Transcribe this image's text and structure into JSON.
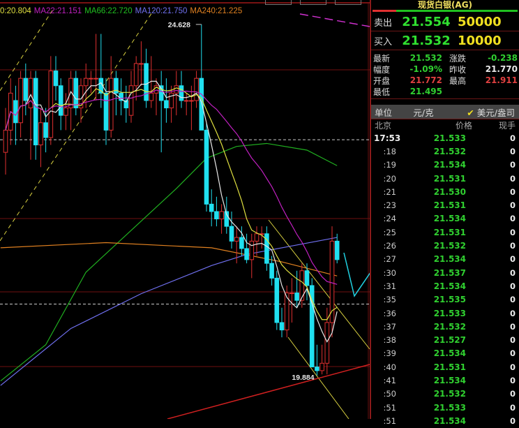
{
  "chart": {
    "legend": [
      {
        "label": "0:20.804",
        "color": "#e0e040"
      },
      {
        "label": "MA22:21.151",
        "color": "#c020c0"
      },
      {
        "label": "MA66:22.720",
        "color": "#20c020"
      },
      {
        "label": "MA120:21.750",
        "color": "#7070f0"
      },
      {
        "label": "MA240:21.225",
        "color": "#e08020"
      }
    ],
    "high_label": "24.628",
    "low_label": "19.884",
    "colors": {
      "up": "#e03030",
      "down": "#20e0f0",
      "grid": "#701010"
    }
  },
  "chart_data": {
    "type": "candlestick",
    "ylim": [
      19.4,
      24.95
    ],
    "hlines_dashed": [
      23.07,
      20.85
    ],
    "candles": [
      [
        22.9,
        23.5,
        22.6,
        23.2
      ],
      [
        23.2,
        23.9,
        23.0,
        23.7
      ],
      [
        23.6,
        23.8,
        23.0,
        23.3
      ],
      [
        23.3,
        24.0,
        23.1,
        23.9
      ],
      [
        23.9,
        24.1,
        23.4,
        23.6
      ],
      [
        23.5,
        24.0,
        22.8,
        23.9
      ],
      [
        23.9,
        24.0,
        22.8,
        23.0
      ],
      [
        23.0,
        23.5,
        22.7,
        23.3
      ],
      [
        23.3,
        23.5,
        22.9,
        23.1
      ],
      [
        23.1,
        24.2,
        23.0,
        24.0
      ],
      [
        24.0,
        24.2,
        23.6,
        23.8
      ],
      [
        23.8,
        23.9,
        23.2,
        23.4
      ],
      [
        23.4,
        23.7,
        23.2,
        23.5
      ],
      [
        23.5,
        24.0,
        23.2,
        23.9
      ],
      [
        23.9,
        24.0,
        23.4,
        23.5
      ],
      [
        23.5,
        23.9,
        23.3,
        23.8
      ],
      [
        23.8,
        24.1,
        23.5,
        23.9
      ],
      [
        23.9,
        24.0,
        23.7,
        23.9
      ],
      [
        23.9,
        24.5,
        23.6,
        23.9
      ],
      [
        23.9,
        24.5,
        23.5,
        23.7
      ],
      [
        23.7,
        23.9,
        23.0,
        23.2
      ],
      [
        23.2,
        24.2,
        23.1,
        23.9
      ],
      [
        23.9,
        24.0,
        23.4,
        23.7
      ],
      [
        23.7,
        23.9,
        23.4,
        23.6
      ],
      [
        23.6,
        23.8,
        23.3,
        23.5
      ],
      [
        23.4,
        24.0,
        23.3,
        23.8
      ],
      [
        23.8,
        24.2,
        23.6,
        24.1
      ],
      [
        24.1,
        24.4,
        23.8,
        24.1
      ],
      [
        24.1,
        24.3,
        23.5,
        23.6
      ],
      [
        23.6,
        24.2,
        23.5,
        23.7
      ],
      [
        23.7,
        23.9,
        23.4,
        23.8
      ],
      [
        23.8,
        24.0,
        22.9,
        23.6
      ],
      [
        23.6,
        23.9,
        23.3,
        23.5
      ],
      [
        23.5,
        23.8,
        23.3,
        23.7
      ],
      [
        23.7,
        24.0,
        23.4,
        23.8
      ],
      [
        23.8,
        24.0,
        23.5,
        23.6
      ],
      [
        23.6,
        23.7,
        23.4,
        23.6
      ],
      [
        23.6,
        23.8,
        23.2,
        23.6
      ],
      [
        23.6,
        24.0,
        23.5,
        23.9
      ],
      [
        23.9,
        24.628,
        23.7,
        23.2
      ],
      [
        23.2,
        23.3,
        22.1,
        22.2
      ],
      [
        22.2,
        22.4,
        21.9,
        22.1
      ],
      [
        22.1,
        22.3,
        21.9,
        22.0
      ],
      [
        22.0,
        22.2,
        21.8,
        22.1
      ],
      [
        22.1,
        22.3,
        21.8,
        21.9
      ],
      [
        21.9,
        22.1,
        21.6,
        21.7
      ],
      [
        21.7,
        21.9,
        21.4,
        21.75
      ],
      [
        21.75,
        21.9,
        21.5,
        21.6
      ],
      [
        21.6,
        21.8,
        21.4,
        21.45
      ],
      [
        21.45,
        21.8,
        21.2,
        21.7
      ],
      [
        21.7,
        21.9,
        21.5,
        21.8
      ],
      [
        21.8,
        21.9,
        21.6,
        21.8
      ],
      [
        21.8,
        21.9,
        21.3,
        21.4
      ],
      [
        21.4,
        21.5,
        21.1,
        21.2
      ],
      [
        21.2,
        21.3,
        20.5,
        20.6
      ],
      [
        20.6,
        20.8,
        20.4,
        20.5
      ],
      [
        20.5,
        21.1,
        20.4,
        21.0
      ],
      [
        21.0,
        21.2,
        20.6,
        21.0
      ],
      [
        21.0,
        21.3,
        20.8,
        20.9
      ],
      [
        20.9,
        21.4,
        20.8,
        21.3
      ],
      [
        21.3,
        21.4,
        20.9,
        21.1
      ],
      [
        21.1,
        21.2,
        20.1,
        20.0
      ],
      [
        20.0,
        20.3,
        19.884,
        19.95
      ],
      [
        19.95,
        20.3,
        19.9,
        20.05
      ],
      [
        20.05,
        20.8,
        19.9,
        20.6
      ],
      [
        20.6,
        21.9,
        20.4,
        21.7
      ],
      [
        21.7,
        21.8,
        21.4,
        21.45
      ]
    ],
    "ma_short": [
      {
        "name": "MA5",
        "period": 5,
        "color": "#e8e8e8"
      },
      {
        "name": "MA10",
        "period": 10,
        "color": "#e0e040"
      },
      {
        "name": "MA22",
        "period": 22,
        "color": "#c020c0"
      }
    ],
    "ma_long": [
      {
        "name": "MA66",
        "color": "#20b020",
        "points": [
          [
            -1,
            19.81
          ],
          [
            8,
            20.3
          ],
          [
            16,
            21.28
          ],
          [
            34,
            22.41
          ],
          [
            40,
            22.82
          ],
          [
            46,
            22.98
          ],
          [
            52,
            23.02
          ],
          [
            60,
            22.93
          ],
          [
            66,
            22.72
          ]
        ]
      },
      {
        "name": "MA120",
        "color": "#7070f0",
        "points": [
          [
            -1,
            19.75
          ],
          [
            13,
            20.52
          ],
          [
            27,
            20.99
          ],
          [
            41,
            21.37
          ],
          [
            48,
            21.52
          ],
          [
            55,
            21.61
          ],
          [
            66,
            21.75
          ]
        ]
      },
      {
        "name": "MA240",
        "color": "#e08020",
        "points": [
          [
            -1,
            21.61
          ],
          [
            20,
            21.68
          ],
          [
            41,
            21.61
          ],
          [
            55,
            21.42
          ],
          [
            66,
            21.23
          ]
        ]
      }
    ]
  },
  "panel": {
    "title": "现货白银(AG)",
    "sell": {
      "label": "卖出",
      "price": "21.554",
      "volume": "50000"
    },
    "buy": {
      "label": "买入",
      "price": "21.532",
      "volume": "10000"
    },
    "stats": [
      {
        "k": "最新",
        "v": "21.532",
        "vc": "g",
        "k2": "涨跌",
        "v2": "-0.238",
        "v2c": "g"
      },
      {
        "k": "幅度",
        "v": "-1.09%",
        "vc": "g",
        "k2": "昨收",
        "v2": "21.770",
        "v2c": "w"
      },
      {
        "k": "开盘",
        "v": "21.772",
        "vc": "rd",
        "k2": "最高",
        "v2": "21.911",
        "v2c": "rd"
      },
      {
        "k": "最低",
        "v": "21.495",
        "vc": "g",
        "k2": "",
        "v2": "",
        "v2c": "w"
      }
    ],
    "unit": {
      "label": "单位",
      "opt1": "元/克",
      "check": "✔",
      "opt2": "美元/盎司"
    },
    "table_header": {
      "time": "北京",
      "price": "价格",
      "vol": "现手"
    },
    "ticks": [
      {
        "t": "17:53",
        "p": "21.533",
        "v": "0"
      },
      {
        "t": ":18",
        "p": "21.532",
        "v": "0"
      },
      {
        "t": ":19",
        "p": "21.534",
        "v": "0"
      },
      {
        "t": ":20",
        "p": "21.531",
        "v": "0"
      },
      {
        "t": ":21",
        "p": "21.530",
        "v": "0"
      },
      {
        "t": ":23",
        "p": "21.531",
        "v": "0"
      },
      {
        "t": ":24",
        "p": "21.534",
        "v": "0"
      },
      {
        "t": ":25",
        "p": "21.531",
        "v": "0"
      },
      {
        "t": ":26",
        "p": "21.532",
        "v": "0"
      },
      {
        "t": ":27",
        "p": "21.534",
        "v": "0"
      },
      {
        "t": ":30",
        "p": "21.537",
        "v": "0"
      },
      {
        "t": ":31",
        "p": "21.534",
        "v": "0"
      },
      {
        "t": ":35",
        "p": "21.535",
        "v": "0"
      },
      {
        "t": ":36",
        "p": "21.533",
        "v": "0"
      },
      {
        "t": ":37",
        "p": "21.532",
        "v": "0"
      },
      {
        "t": ":38",
        "p": "21.527",
        "v": "0"
      },
      {
        "t": ":39",
        "p": "21.534",
        "v": "0"
      },
      {
        "t": ":40",
        "p": "21.531",
        "v": "0"
      },
      {
        "t": ":41",
        "p": "21.534",
        "v": "0"
      },
      {
        "t": ":50",
        "p": "21.532",
        "v": "0"
      },
      {
        "t": ":51",
        "p": "21.533",
        "v": "0"
      },
      {
        "t": ":51",
        "p": "21.534",
        "v": "0"
      }
    ]
  }
}
